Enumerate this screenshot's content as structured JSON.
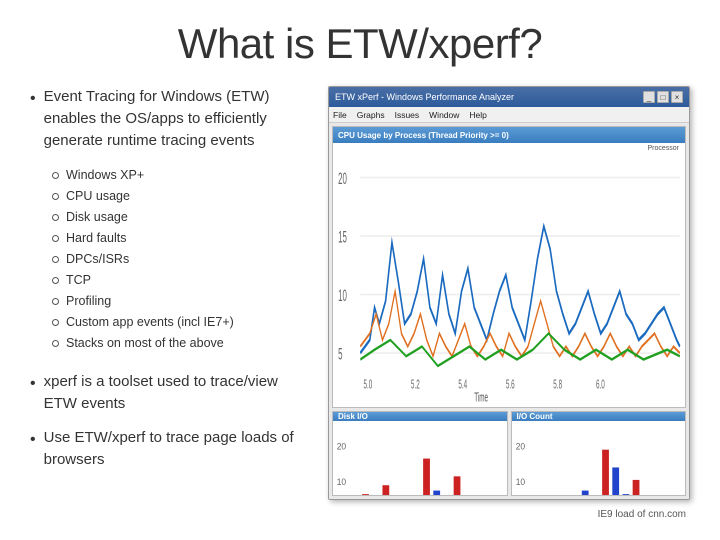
{
  "title": "What is ETW/xperf?",
  "slide": {
    "main_bullet": {
      "text": "Event Tracing for Windows (ETW) enables the OS/apps to efficiently generate runtime tracing events"
    },
    "sub_items": [
      "Windows XP+",
      "CPU usage",
      "Disk usage",
      "Hard faults",
      "DPCs/ISRs",
      "TCP",
      "Profiling",
      "Custom app events (incl IE7+)",
      "Stacks on most of the above"
    ],
    "bottom_bullets": [
      "xperf is a toolset used to trace/view ETW events",
      "Use ETW/xperf to trace page loads of browsers"
    ],
    "wpa_window": {
      "title": "ETW xPerf - Windows Performance Analyzer",
      "menu_items": [
        "File",
        "Graphs",
        "Issues",
        "Window",
        "Help"
      ],
      "top_panel_title": "CPU Usage by Process (Thread Priority >= 0)",
      "processor_label": "Processor",
      "bottom_left_title": "Disk I/O",
      "bottom_right_title": "I/O Count",
      "ie9_caption": "IE9 load of cnn.com"
    }
  }
}
